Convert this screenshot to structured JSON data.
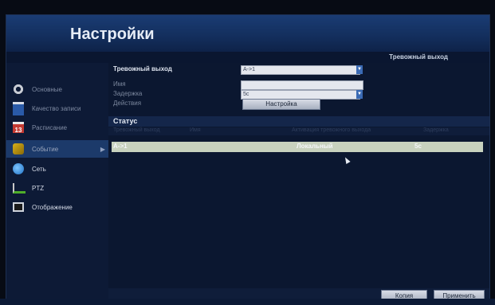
{
  "window": {
    "title": "Настройки"
  },
  "topbar": {
    "right_title": "Тревожный выход"
  },
  "sidebar": {
    "items": [
      {
        "label": "Основные",
        "icon": "gear-icon"
      },
      {
        "label": "Качество записи",
        "icon": "film-icon"
      },
      {
        "label": "Расписание",
        "icon": "calendar-icon",
        "icon_text": "13"
      },
      {
        "label": "Событие",
        "icon": "alarm-icon",
        "active": true,
        "arrow": "▶"
      },
      {
        "label": "Сеть",
        "icon": "network-icon"
      },
      {
        "label": "PTZ",
        "icon": "ptz-icon"
      },
      {
        "label": "Отображение",
        "icon": "monitor-icon"
      }
    ]
  },
  "form": {
    "alarm_output_label": "Тревожный выход",
    "alarm_output_value": "A->1",
    "name_label": "Имя",
    "name_value": "",
    "delay_label": "Задержка",
    "delay_value": "5с",
    "action_label": "Действия",
    "setup_button": "Настройка"
  },
  "status": {
    "title": "Статус",
    "columns": [
      "Тревожный выход",
      "Имя",
      "Активация тревожного выхода",
      "Задержка"
    ],
    "rows": [
      {
        "output": "A->1",
        "activation": "Локальный",
        "delay": "5с"
      }
    ]
  },
  "footer": {
    "copy_button": "Копия",
    "apply_button": "Применить"
  },
  "colors": {
    "accent_blue": "#1c3a6a",
    "titlebar_blue": "#1a3c74",
    "selected_row": "#c8d2be"
  }
}
